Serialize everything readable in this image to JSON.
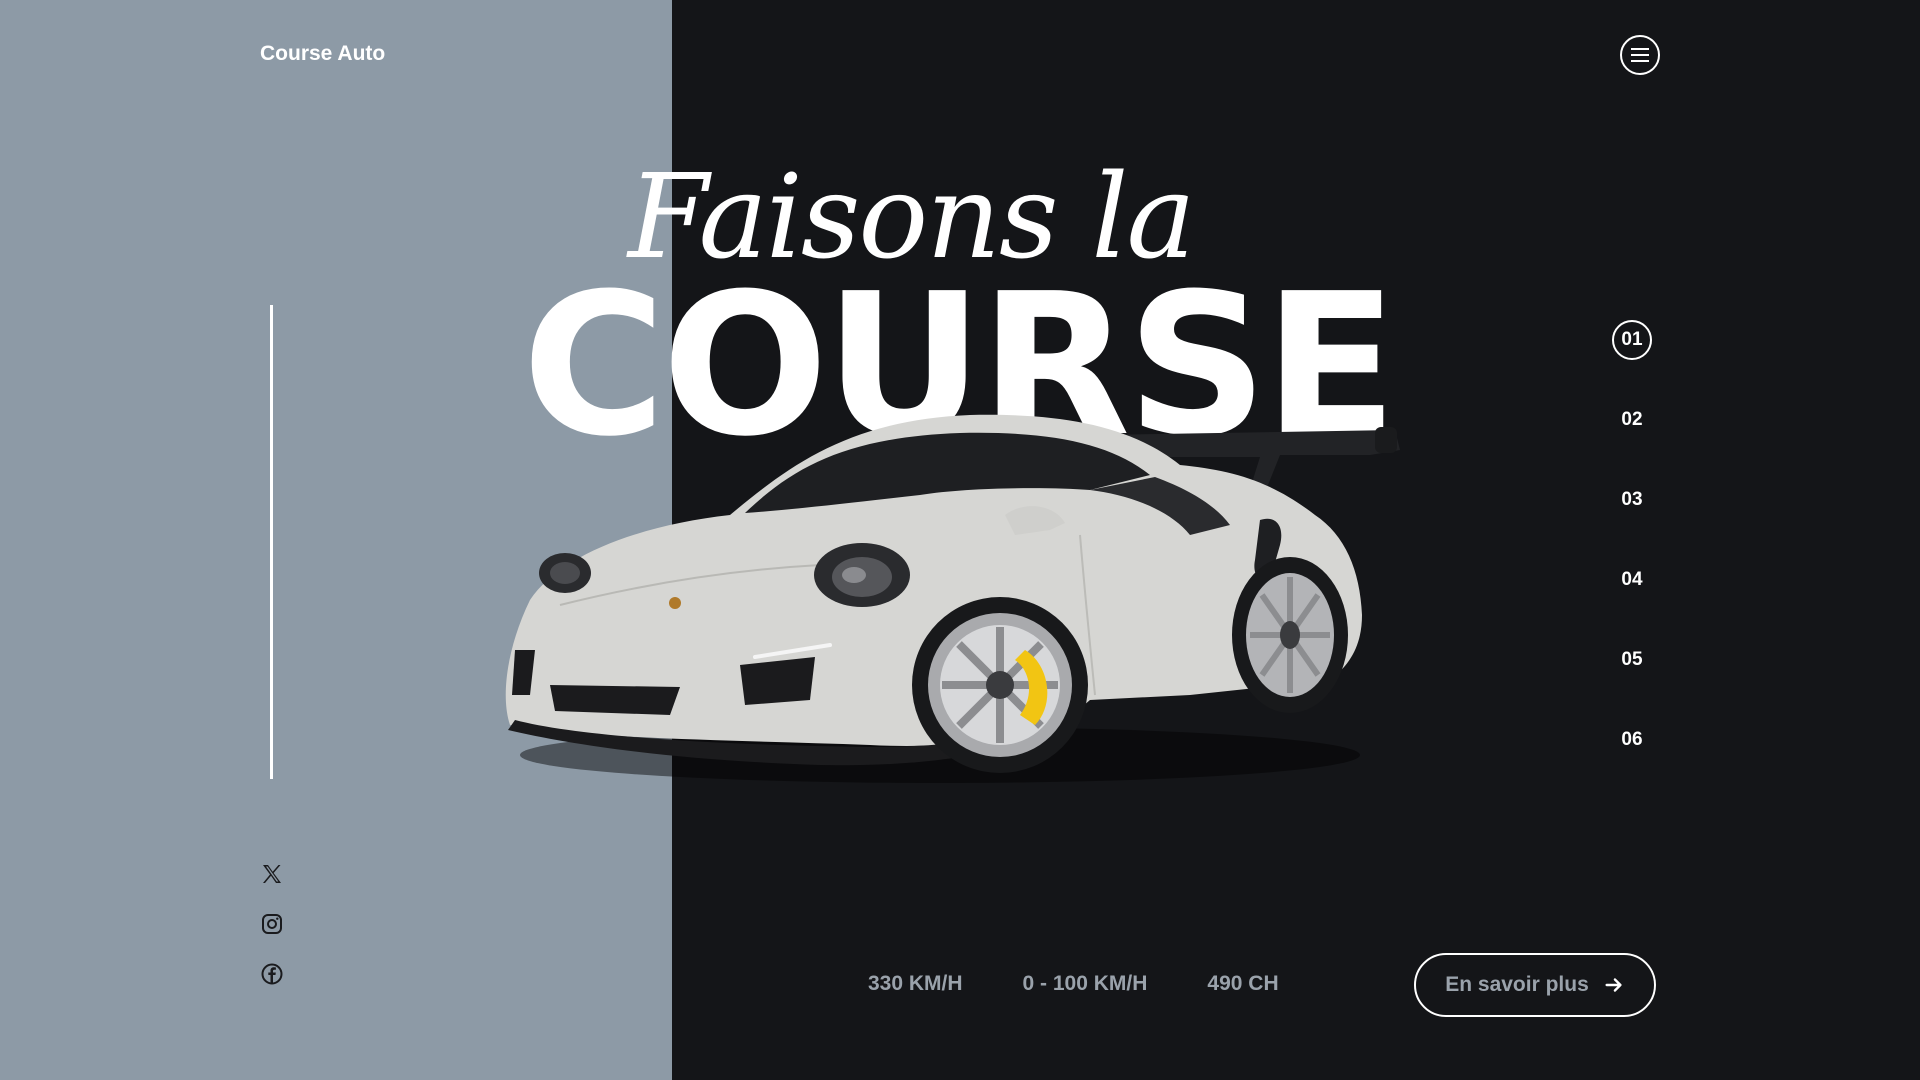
{
  "brand": {
    "name": "Course Auto"
  },
  "hero": {
    "script_title": "Faisons la",
    "big_title": "COURSE"
  },
  "slides": [
    "01",
    "02",
    "03",
    "04",
    "05",
    "06"
  ],
  "active_slide": "01",
  "stats": [
    "330 KM/H",
    "0 - 100 KM/H",
    "490 CH"
  ],
  "cta": {
    "label": "En savoir plus"
  },
  "icons": {
    "menu": "hamburger-icon",
    "cta_arrow": "arrow-right-icon",
    "socials": [
      "x-icon",
      "instagram-icon",
      "facebook-icon"
    ]
  },
  "colors": {
    "left_panel": "#8d9aa6",
    "background": "#141518",
    "car_body": "#d6d6d3",
    "caliper": "#f2c513"
  }
}
